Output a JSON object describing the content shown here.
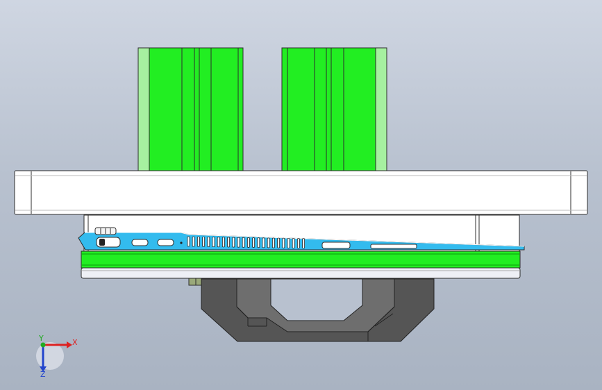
{
  "viewport": {
    "background_top": "#cfd6e2",
    "background_bottom": "#a9b3c2"
  },
  "colors": {
    "green": "#22ee22",
    "green_dark": "#0c9a0c",
    "plate": "#ffffff",
    "cyan": "#33bbee",
    "bracket": "#555555",
    "outline": "#2c2c2c"
  },
  "triad": {
    "x_label": "X",
    "y_label": "Y",
    "z_label": "Z",
    "x_color": "#dd2222",
    "y_color": "#22aa22",
    "z_color": "#2244cc"
  }
}
